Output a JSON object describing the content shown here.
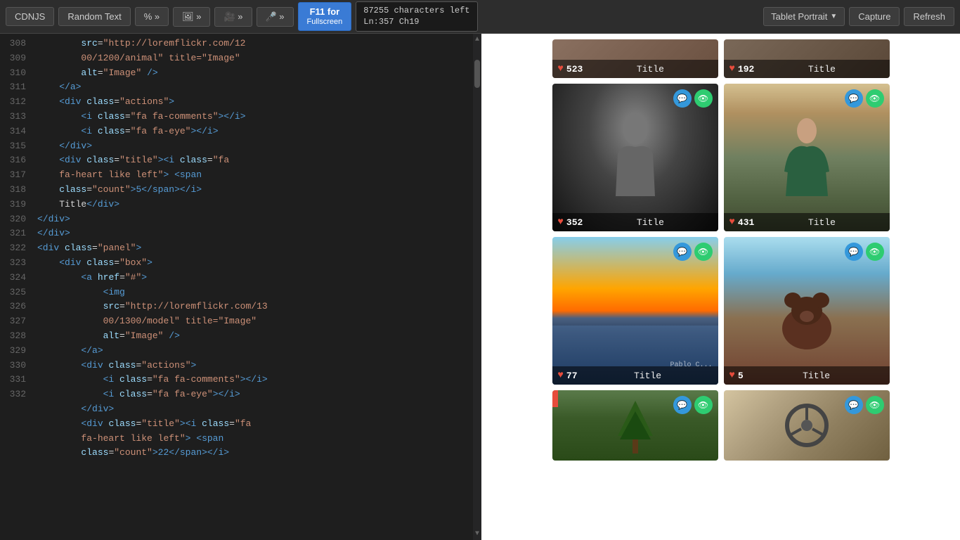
{
  "toolbar": {
    "cdnjs_label": "CDNJS",
    "random_text_label": "Random Text",
    "symbols_label": "% »",
    "image_label": "🖼 »",
    "video_label": "🎥 »",
    "mic_label": "🎤 »",
    "f11_line1": "F11 for",
    "f11_line2": "Fullscreen",
    "chars_line1": "87255 characters left",
    "chars_line2": "Ln:357 Ch19",
    "tablet_portrait": "Tablet Portrait",
    "capture": "Capture",
    "refresh": "Refresh"
  },
  "editor": {
    "lines": [
      308,
      309,
      310,
      311,
      312,
      313,
      314,
      315,
      316,
      317,
      318,
      319,
      320,
      321,
      322,
      323,
      324,
      325,
      326,
      327,
      328,
      329,
      330,
      331,
      332
    ],
    "code": [
      "        src=\"http://loremflickr.com/1200/1200/animal\" title=\"Image\"",
      "        alt=\"Image\" />",
      "    </a>",
      "    <div class=\"actions\">",
      "        <i class=\"fa fa-comments\"></i>",
      "        <i class=\"fa fa-eye\"></i>",
      "    </div>",
      "    <div class=\"title\"><i class=\"fa fa-heart like left\"> <span",
      "        class=\"count\">5</span></i>",
      "        Title</div>",
      "</div>",
      "</div>",
      "<div class=\"panel\">",
      "    <div class=\"box\">",
      "        <a href=\"#\">",
      "            <img",
      "            src=\"http://loremflickr.com/1300/1300/model\" title=\"Image\"",
      "            alt=\"Image\" />",
      "        </a>",
      "        <div class=\"actions\">",
      "            <i class=\"fa fa-comments\"></i>",
      "            <i class=\"fa fa-eye\"></i>",
      "        </div>",
      "        <div class=\"title\"><i class=\"fa fa-heart like left\"> <span",
      "        class=\"count\">22</span></i>"
    ]
  },
  "preview": {
    "cards": [
      {
        "id": "card1",
        "count": "523",
        "title": "Title",
        "has_top_icons": false,
        "bg": "#8a7a6a",
        "row": "top"
      },
      {
        "id": "card2",
        "count": "192",
        "title": "Title",
        "has_top_icons": false,
        "bg": "#7a6a5a",
        "row": "top"
      },
      {
        "id": "card3",
        "count": "352",
        "title": "Title",
        "has_top_icons": true,
        "bg": "#2a2a2a",
        "row": "mid"
      },
      {
        "id": "card4",
        "count": "431",
        "title": "Title",
        "has_top_icons": true,
        "bg": "#a08060",
        "row": "mid"
      },
      {
        "id": "card5",
        "count": "77",
        "title": "Title",
        "has_top_icons": true,
        "bg": "#4a7a9a",
        "watermark": "Pablo C...",
        "row": "mid"
      },
      {
        "id": "card6",
        "count": "5",
        "title": "Title",
        "has_top_icons": true,
        "bg": "#8a5a3a",
        "row": "mid"
      },
      {
        "id": "card7",
        "count": "",
        "title": "",
        "has_top_icons": true,
        "bg": "#5a4a3a",
        "row": "bot",
        "has_red_tag": true
      },
      {
        "id": "card8",
        "count": "",
        "title": "",
        "has_top_icons": true,
        "bg": "#b0a090",
        "row": "bot"
      }
    ],
    "chat_icon": "💬",
    "eye_icon": "👁"
  }
}
